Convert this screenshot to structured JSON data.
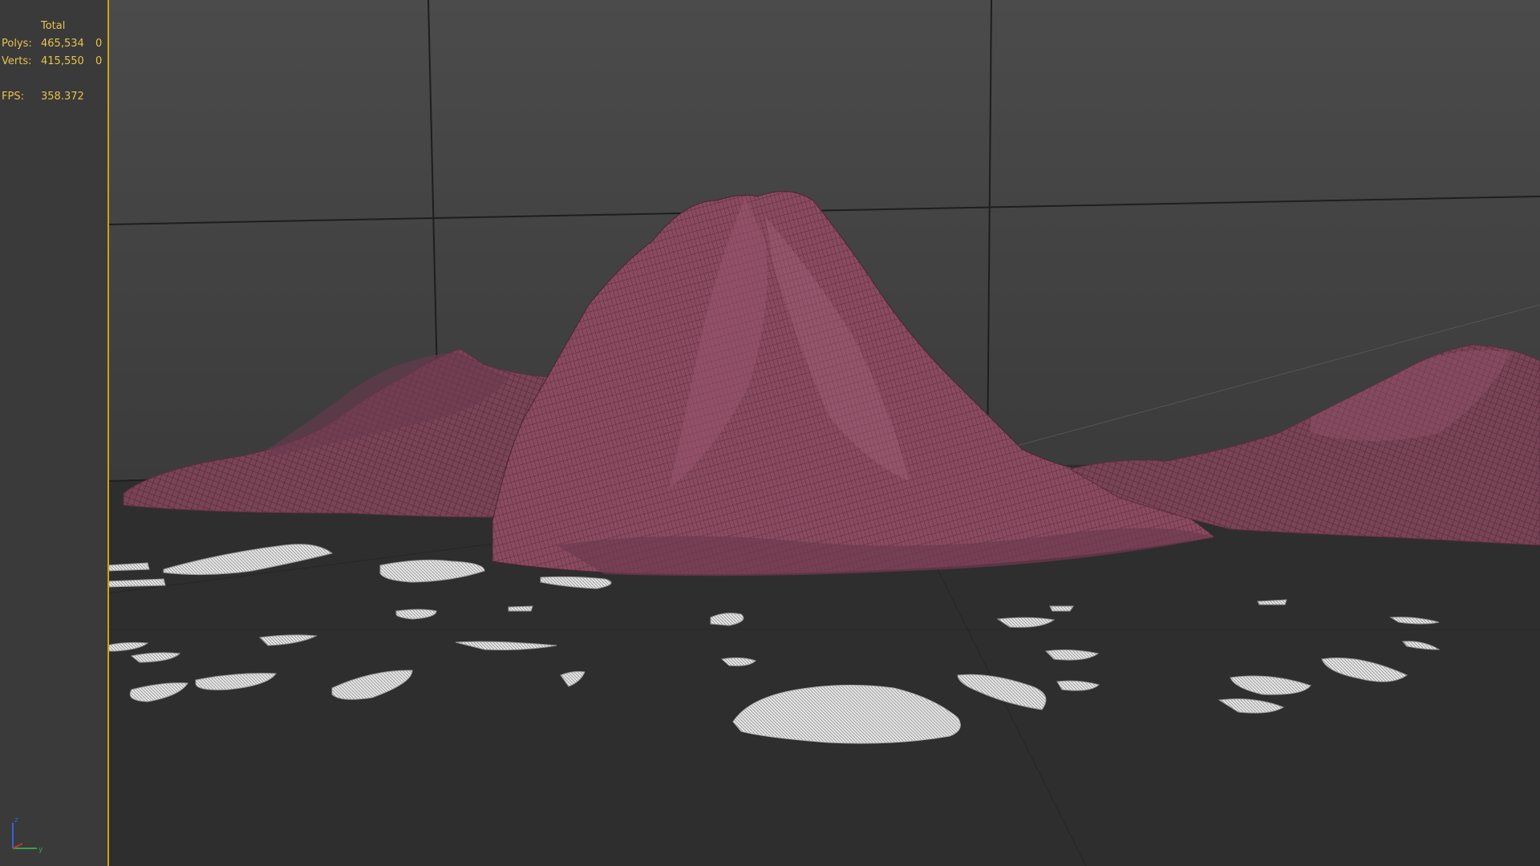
{
  "stats": {
    "header": "Total",
    "rows": [
      {
        "label": "Polys:",
        "value": "465,534",
        "selected": "0"
      },
      {
        "label": "Verts:",
        "value": "415,550",
        "selected": "0"
      }
    ],
    "fps": {
      "label": "FPS:",
      "value": "358.372"
    }
  },
  "gizmo": {
    "z_label": "z",
    "y_label": "y"
  },
  "colors": {
    "stats_text": "#e6c34a",
    "viewport_border": "#c8a418",
    "terrain": "#7a4356",
    "terrain_wire": "#3b1f2a",
    "islands": "#d8d8d8"
  }
}
